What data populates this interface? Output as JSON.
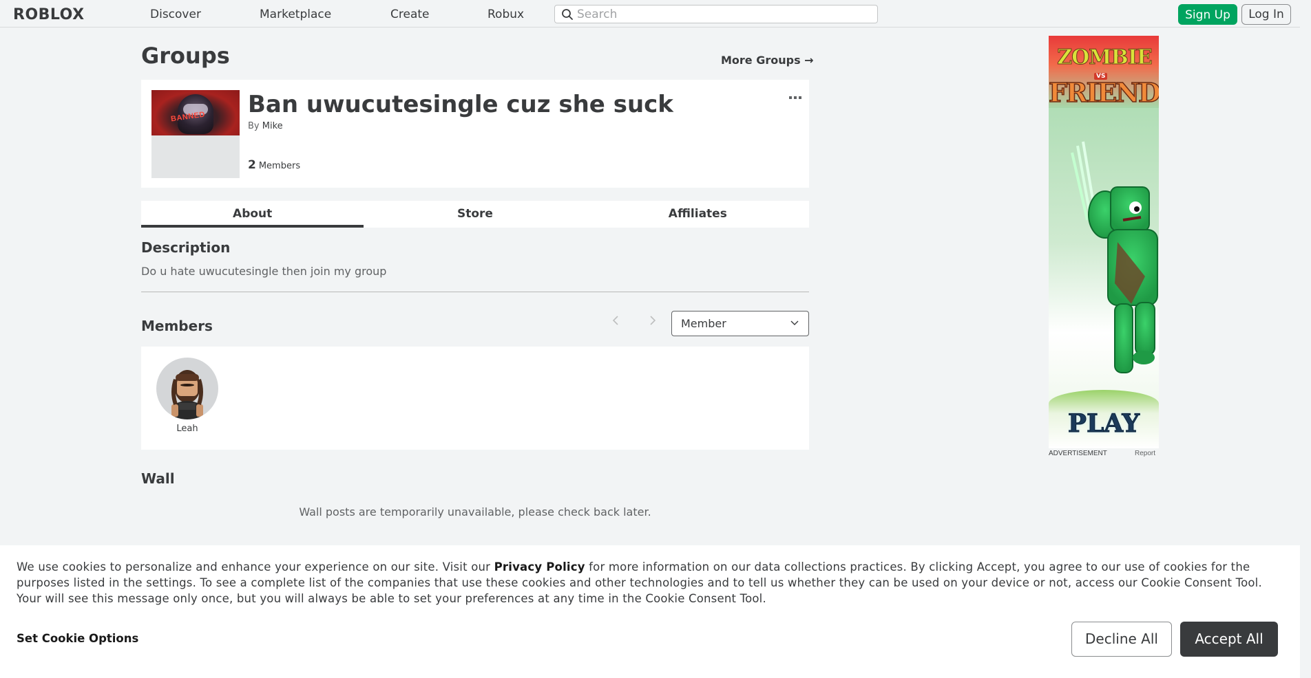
{
  "nav": {
    "logo": "ROBLOX",
    "links": [
      "Discover",
      "Marketplace",
      "Create",
      "Robux"
    ],
    "search_placeholder": "Search",
    "signup": "Sign Up",
    "login": "Log In"
  },
  "page": {
    "title": "Groups",
    "more_groups": "More Groups →"
  },
  "group": {
    "emblem_text": "BANNED",
    "name": "Ban uwucutesingle cuz she suck",
    "by_label": "By",
    "owner": "Mike",
    "member_count": "2",
    "members_label": "Members",
    "menu_icon": "ellipsis-icon"
  },
  "tabs": [
    "About",
    "Store",
    "Affiliates"
  ],
  "active_tab": "About",
  "description": {
    "title": "Description",
    "text": "Do u hate uwucutesingle then join my group"
  },
  "members": {
    "title": "Members",
    "role_selected": "Member",
    "list": [
      {
        "name": "Leah"
      }
    ]
  },
  "wall": {
    "title": "Wall",
    "message": "Wall posts are temporarily unavailable, please check back later."
  },
  "ad": {
    "title_line1": "ZOMBIE",
    "title_vs": "VS",
    "title_line2": "FRIEND",
    "cta": "PLAY",
    "label": "ADVERTISEMENT",
    "report": "Report"
  },
  "cookie": {
    "text_before": "We use cookies to personalize and enhance your experience on our site. Visit our ",
    "privacy_policy": "Privacy Policy",
    "text_after": " for more information on our data collections practices. By clicking Accept, you agree to our use of cookies for the purposes listed in the settings. To see a complete list of the companies that use these cookies and other technologies and to tell us whether they can be used on your device or not, access our Cookie Consent Tool. Your will see this message only once, but you will always be able to set your preferences at any time in the Cookie Consent Tool.",
    "set_options": "Set Cookie Options",
    "decline": "Decline All",
    "accept": "Accept All"
  },
  "colors": {
    "signup_green": "#00a45f",
    "accept_dark": "#393b3d",
    "page_bg": "#f2f4f5"
  }
}
